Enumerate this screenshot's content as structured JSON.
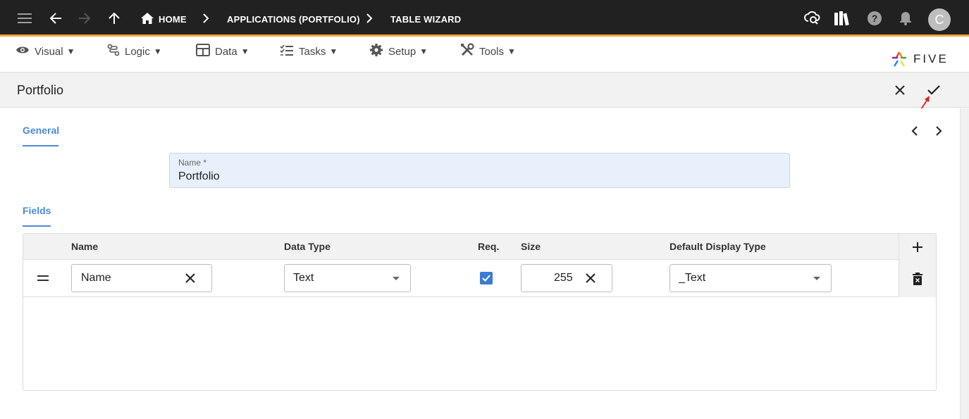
{
  "topbar": {
    "breadcrumbs": [
      "HOME",
      "APPLICATIONS (PORTFOLIO)",
      "TABLE WIZARD"
    ],
    "avatar_initial": "C",
    "icons": [
      "menu-icon",
      "back-arrow-icon",
      "forward-arrow-icon",
      "up-arrow-icon",
      "home-icon",
      "cloud-sync-icon",
      "library-icon",
      "help-icon",
      "notifications-icon"
    ],
    "accent": "#f2a93b"
  },
  "menubar": {
    "items": [
      {
        "label": "Visual",
        "icon": "eye-icon"
      },
      {
        "label": "Logic",
        "icon": "logic-icon"
      },
      {
        "label": "Data",
        "icon": "table-icon"
      },
      {
        "label": "Tasks",
        "icon": "checklist-icon"
      },
      {
        "label": "Setup",
        "icon": "gear-icon"
      },
      {
        "label": "Tools",
        "icon": "tools-icon"
      }
    ],
    "caret": "▼",
    "logo_text": "FIVE"
  },
  "form": {
    "title": "Portfolio",
    "tabs": {
      "general": "General",
      "fields": "Fields"
    },
    "name_field": {
      "label": "Name *",
      "value": "Portfolio",
      "bg": "#e8f1fb"
    },
    "grid": {
      "columns": [
        "Name",
        "Data Type",
        "Req.",
        "Size",
        "Default Display Type"
      ],
      "rows": [
        {
          "name": "Name",
          "data_type": "Text",
          "required": true,
          "size": "255",
          "display_type": "_Text"
        }
      ]
    }
  },
  "colors": {
    "tab_accent": "#4a8ad8",
    "checkbox": "#3a7bd5",
    "annotation_arrow": "#e02020"
  }
}
